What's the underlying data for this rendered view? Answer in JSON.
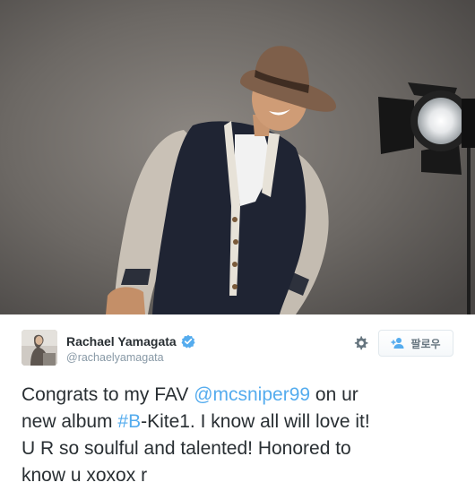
{
  "photo": {
    "subject": "man-in-hat-and-cardigan",
    "icons": [
      "fedora-hat-icon",
      "sunglasses-icon",
      "studio-light-icon"
    ]
  },
  "tweet": {
    "author": {
      "display_name": "Rachael Yamagata",
      "handle": "@rachaelyamagata",
      "verified": true,
      "avatar_icon": "avatar-photo-icon"
    },
    "actions": {
      "settings_icon": "gear-icon",
      "follow_label": "팔로우",
      "follow_icon": "add-user-icon"
    },
    "text": {
      "line1": {
        "pre": "Congrats to my FAV ",
        "mention": "@mcsniper99",
        "post": " on ur"
      },
      "line2": {
        "pre": "new album ",
        "hashtag": "#B",
        "post": "-Kite1. I know all will love it!"
      },
      "line3": "U R so soulful and talented! Honored to",
      "line4": "know u xoxox r"
    },
    "colors": {
      "link": "#55acee",
      "text": "#292f33",
      "muted": "#8899a6",
      "verified": "#55acee"
    }
  }
}
